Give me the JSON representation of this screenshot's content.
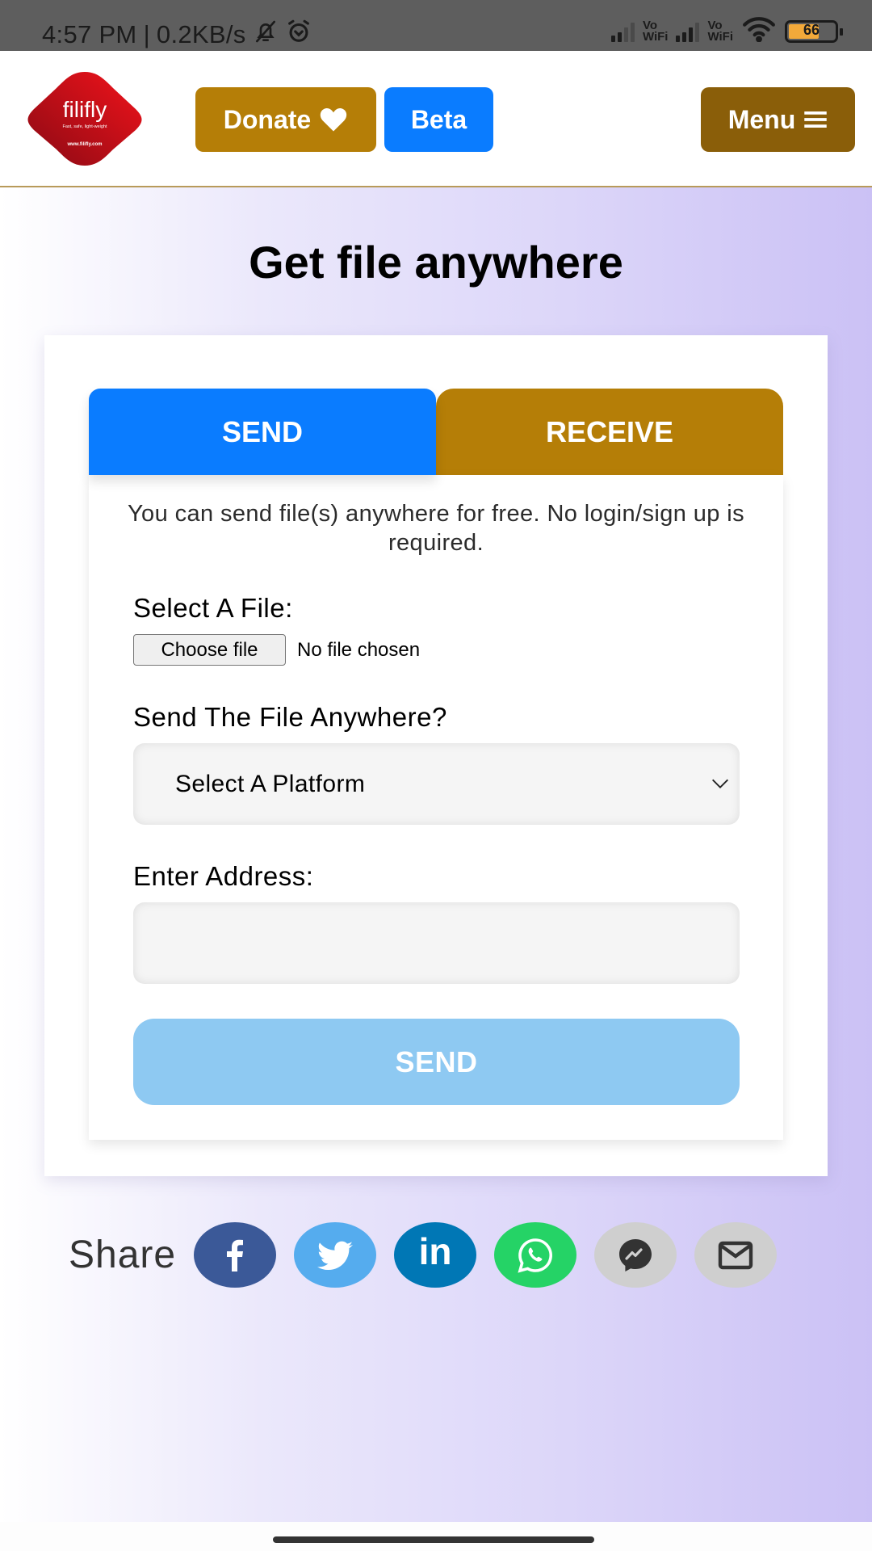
{
  "status_bar": {
    "time": "4:57 PM",
    "separator": "|",
    "network_speed": "0.2KB/s",
    "icons": [
      "bell-off-icon",
      "alarm-icon",
      "signal-icon",
      "vowifi-icon",
      "signal-icon",
      "vowifi-icon",
      "wifi-icon",
      "battery-icon"
    ],
    "vowifi_top": "Vo",
    "vowifi_bottom": "WiFi",
    "battery_level": "66"
  },
  "header": {
    "logo": {
      "name": "filifly",
      "tagline": "Fast, safe, light-weight",
      "url_text": "www.filifly.com"
    },
    "donate_label": "Donate",
    "beta_label": "Beta",
    "menu_label": "Menu"
  },
  "main": {
    "title": "Get file anywhere",
    "tabs": [
      {
        "label": "SEND",
        "active": true
      },
      {
        "label": "RECEIVE",
        "active": false
      }
    ],
    "intro": "You can send file(s) anywhere for free. No login/sign up is required.",
    "file_label": "Select A File:",
    "choose_file_label": "Choose file",
    "no_file_text": "No file chosen",
    "platform_label": "Send The File Anywhere?",
    "platform_selected": "Select A Platform",
    "address_label": "Enter Address:",
    "address_value": "",
    "address_placeholder": "",
    "send_button_label": "SEND"
  },
  "share": {
    "label": "Share",
    "buttons": [
      {
        "name": "facebook",
        "icon": "facebook-icon"
      },
      {
        "name": "twitter",
        "icon": "twitter-icon"
      },
      {
        "name": "linkedin",
        "icon": "linkedin-icon"
      },
      {
        "name": "whatsapp",
        "icon": "whatsapp-icon"
      },
      {
        "name": "messenger",
        "icon": "messenger-icon"
      },
      {
        "name": "email",
        "icon": "email-icon"
      }
    ],
    "linkedin_text": "in"
  },
  "colors": {
    "primary_blue": "#0a7cff",
    "gold": "#b57e07",
    "dark_gold": "#8a5e09",
    "send_disabled": "#8ec9f2",
    "facebook": "#3b5998",
    "twitter": "#55acee",
    "linkedin": "#0077b5",
    "whatsapp": "#25d366"
  }
}
